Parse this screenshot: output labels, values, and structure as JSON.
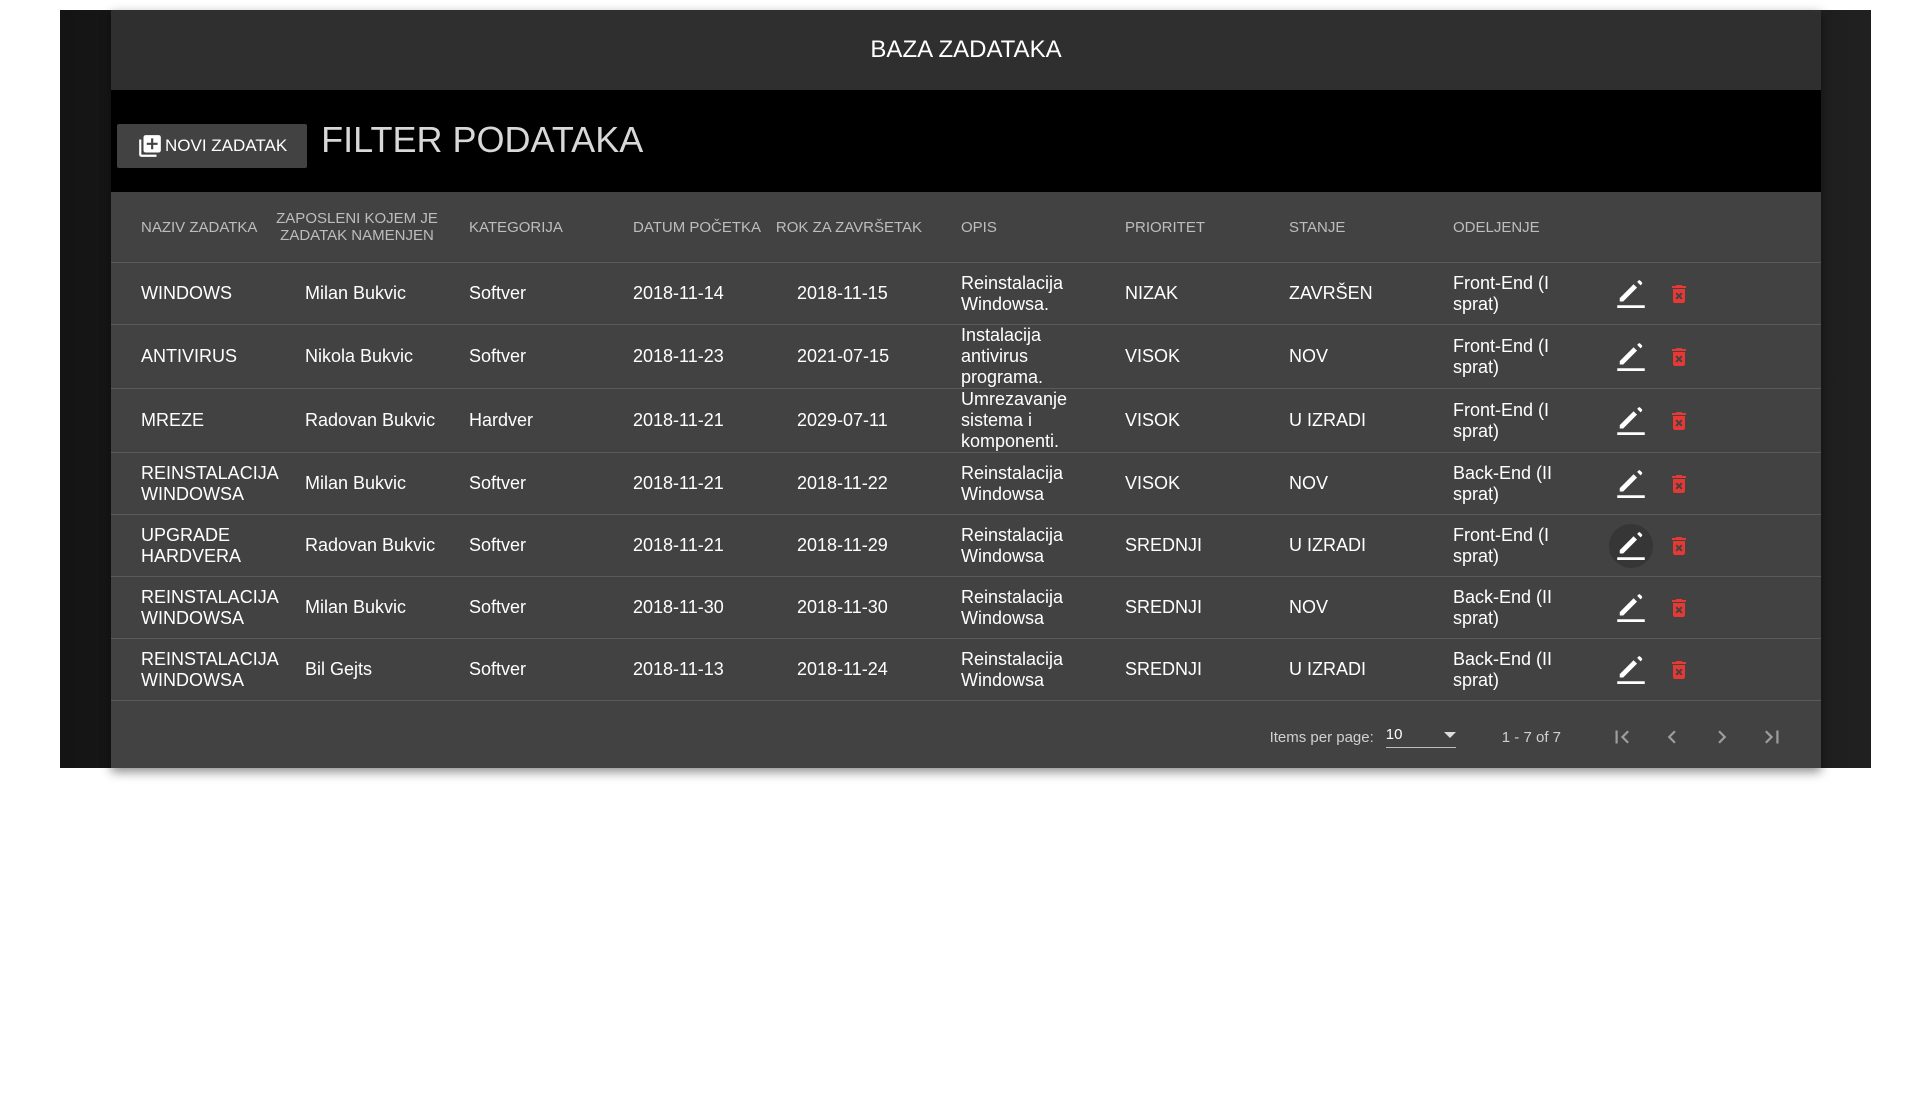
{
  "header": {
    "title": "BAZA ZADATAKA"
  },
  "toolbar": {
    "new_task_label": "NOVI ZADATAK",
    "filter_title": "FILTER PODATAKA"
  },
  "table": {
    "columns": [
      "NAZIV ZADATKA",
      "ZAPOSLENI KOJEM JE ZADATAK NAMENJEN",
      "KATEGORIJA",
      "DATUM POČETKA",
      "ROK ZA ZAVRŠETAK",
      "OPIS",
      "PRIORITET",
      "STANJE",
      "ODELJENJE"
    ],
    "rows": [
      {
        "naziv": "WINDOWS",
        "zaposleni": "Milan Bukvic",
        "kategorija": "Softver",
        "datum": "2018-11-14",
        "rok": "2018-11-15",
        "opis": "Reinstalacija Windowsa.",
        "prioritet": "NIZAK",
        "stanje": "ZAVRŠEN",
        "odeljenje": "Front-End (I sprat)"
      },
      {
        "naziv": "ANTIVIRUS",
        "zaposleni": "Nikola Bukvic",
        "kategorija": "Softver",
        "datum": "2018-11-23",
        "rok": "2021-07-15",
        "opis": "Instalacija antivirus programa.",
        "prioritet": "VISOK",
        "stanje": "NOV",
        "odeljenje": "Front-End (I sprat)"
      },
      {
        "naziv": "MREZE",
        "zaposleni": "Radovan Bukvic",
        "kategorija": "Hardver",
        "datum": "2018-11-21",
        "rok": "2029-07-11",
        "opis": "Umrezavanje sistema i komponenti.",
        "prioritet": "VISOK",
        "stanje": "U IZRADI",
        "odeljenje": "Front-End (I sprat)"
      },
      {
        "naziv": "REINSTALACIJA WINDOWSA",
        "zaposleni": "Milan Bukvic",
        "kategorija": "Softver",
        "datum": "2018-11-21",
        "rok": "2018-11-22",
        "opis": "Reinstalacija Windowsa",
        "prioritet": "VISOK",
        "stanje": "NOV",
        "odeljenje": "Back-End (II sprat)"
      },
      {
        "naziv": "UPGRADE HARDVERA",
        "zaposleni": "Radovan Bukvic",
        "kategorija": "Softver",
        "datum": "2018-11-21",
        "rok": "2018-11-29",
        "opis": "Reinstalacija Windowsa",
        "prioritet": "SREDNJI",
        "stanje": "U IZRADI",
        "odeljenje": "Front-End (I sprat)"
      },
      {
        "naziv": "REINSTALACIJA WINDOWSA",
        "zaposleni": "Milan Bukvic",
        "kategorija": "Softver",
        "datum": "2018-11-30",
        "rok": "2018-11-30",
        "opis": "Reinstalacija Windowsa",
        "prioritet": "SREDNJI",
        "stanje": "NOV",
        "odeljenje": "Back-End (II sprat)"
      },
      {
        "naziv": "REINSTALACIJA WINDOWSA",
        "zaposleni": "Bil Gejts",
        "kategorija": "Softver",
        "datum": "2018-11-13",
        "rok": "2018-11-24",
        "opis": "Reinstalacija Windowsa",
        "prioritet": "SREDNJI",
        "stanje": "U IZRADI",
        "odeljenje": "Back-End (II sprat)"
      }
    ],
    "hovered_edit_row": 4,
    "row_icons": {
      "edit": "pencil-icon",
      "delete": "trash-icon"
    }
  },
  "paginator": {
    "items_per_page_label": "Items per page:",
    "items_per_page_value": "10",
    "range_label": "1 - 7 of 7",
    "icons": [
      "first-page-icon",
      "previous-page-icon",
      "next-page-icon",
      "last-page-icon"
    ]
  },
  "colors": {
    "header_bg": "#2f2f2f",
    "card_bg": "#424242",
    "filter_bar_bg": "#000000",
    "delete_red": "#e53935"
  }
}
